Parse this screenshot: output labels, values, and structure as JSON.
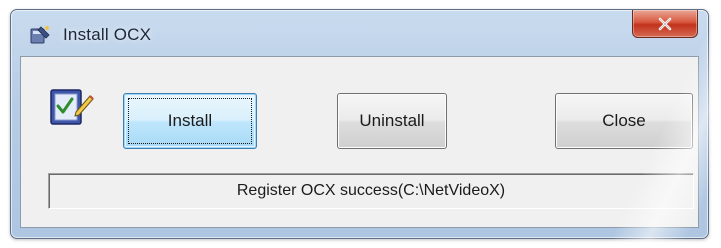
{
  "window": {
    "title": "Install OCX",
    "title_icon": "install-wizard-icon",
    "close_icon": "close-icon"
  },
  "body": {
    "app_icon": "checklist-pen-icon",
    "buttons": {
      "install_label": "Install",
      "uninstall_label": "Uninstall",
      "close_label": "Close"
    },
    "status_text": "Register OCX success(C:\\NetVideoX)"
  },
  "colors": {
    "titlebar": "#b7cde6",
    "client_bg": "#f0f0f0",
    "close_button": "#c2321c",
    "default_button": "#bee6fd"
  }
}
